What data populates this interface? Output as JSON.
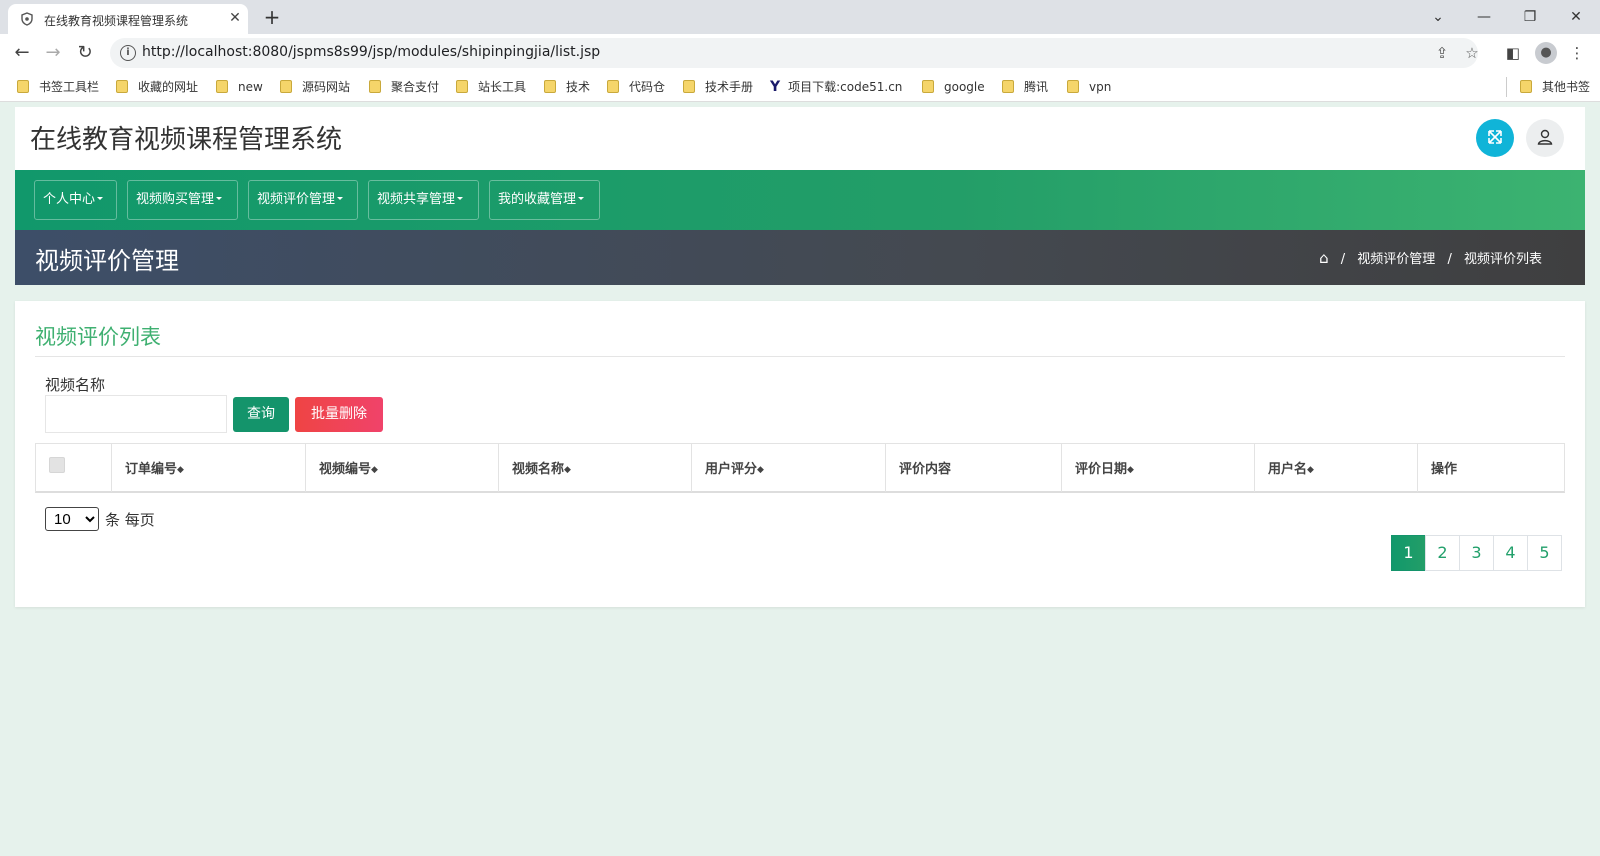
{
  "browser": {
    "tab_title": "在线教育视频课程管理系统",
    "url": "http://localhost:8080/jspms8s99/jsp/modules/shipinpingjia/list.jsp",
    "bookmarks": [
      "书签工具栏",
      "收藏的网址",
      "new",
      "源码网站",
      "聚合支付",
      "站长工具",
      "技术",
      "代码仓",
      "技术手册",
      "项目下载:code51.cn",
      "google",
      "腾讯",
      "vpn"
    ],
    "other_bookmarks": "其他书签"
  },
  "site": {
    "title": "在线教育视频课程管理系统"
  },
  "nav": {
    "items": [
      "个人中心",
      "视频购买管理",
      "视频评价管理",
      "视频共享管理",
      "我的收藏管理"
    ]
  },
  "page": {
    "title": "视频评价管理",
    "breadcrumb": [
      "视频评价管理",
      "视频评价列表"
    ]
  },
  "list": {
    "title": "视频评价列表",
    "filter_label": "视频名称",
    "filter_value": "",
    "query_button": "查询",
    "batch_delete_button": "批量删除",
    "columns": [
      "订单编号",
      "视频编号",
      "视频名称",
      "用户评分",
      "评价内容",
      "评价日期",
      "用户名",
      "操作"
    ],
    "rows": [],
    "page_size": "10",
    "page_size_label": "条 每页",
    "pages": [
      "1",
      "2",
      "3",
      "4",
      "5"
    ],
    "current_page": "1"
  },
  "icons": {
    "accent": "#14946b",
    "title_color": "#3fb071",
    "danger": "#ef4444",
    "expand": "#10b4d8"
  }
}
